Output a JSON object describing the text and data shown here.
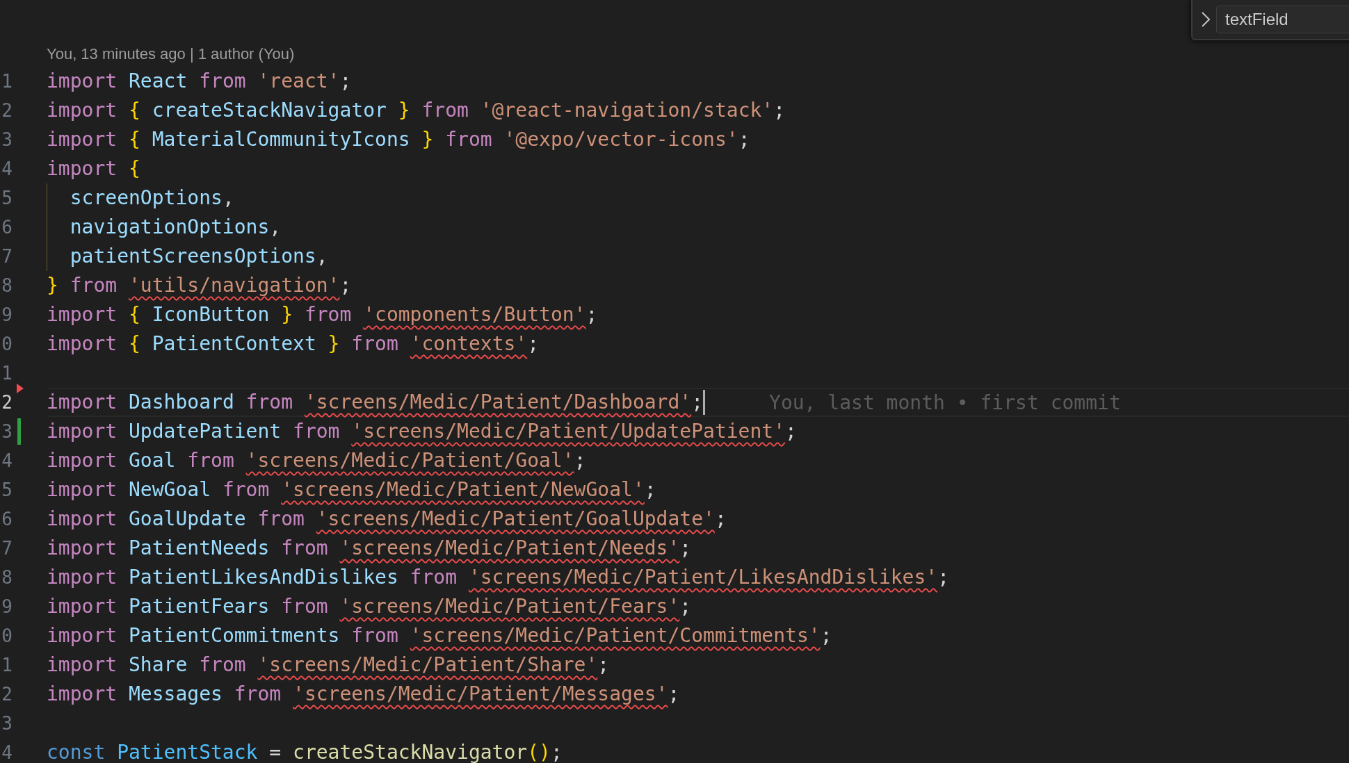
{
  "find_widget": {
    "value": "textField"
  },
  "codelens": "You, 13 minutes ago | 1 author (You)",
  "lines": [
    {
      "number": "1",
      "current": false,
      "tokens": [
        {
          "kind": "keyword",
          "text": "import "
        },
        {
          "kind": "ident",
          "text": "React "
        },
        {
          "kind": "keyword",
          "text": "from "
        },
        {
          "kind": "string",
          "text": "'react'"
        },
        {
          "kind": "punct",
          "text": ";"
        }
      ]
    },
    {
      "number": "2",
      "current": false,
      "tokens": [
        {
          "kind": "keyword",
          "text": "import "
        },
        {
          "kind": "brace",
          "text": "{ "
        },
        {
          "kind": "ident",
          "text": "createStackNavigator "
        },
        {
          "kind": "brace",
          "text": "} "
        },
        {
          "kind": "keyword",
          "text": "from "
        },
        {
          "kind": "string",
          "text": "'@react-navigation/stack'"
        },
        {
          "kind": "punct",
          "text": ";"
        }
      ]
    },
    {
      "number": "3",
      "current": false,
      "tokens": [
        {
          "kind": "keyword",
          "text": "import "
        },
        {
          "kind": "brace",
          "text": "{ "
        },
        {
          "kind": "ident",
          "text": "MaterialCommunityIcons "
        },
        {
          "kind": "brace",
          "text": "} "
        },
        {
          "kind": "keyword",
          "text": "from "
        },
        {
          "kind": "string",
          "text": "'@expo/vector-icons'"
        },
        {
          "kind": "punct",
          "text": ";"
        }
      ]
    },
    {
      "number": "4",
      "current": false,
      "tokens": [
        {
          "kind": "keyword",
          "text": "import "
        },
        {
          "kind": "brace",
          "text": "{"
        }
      ]
    },
    {
      "number": "5",
      "current": false,
      "indent_guide": true,
      "tokens": [
        {
          "kind": "ident",
          "text": "  screenOptions"
        },
        {
          "kind": "punct",
          "text": ","
        }
      ]
    },
    {
      "number": "6",
      "current": false,
      "indent_guide": true,
      "tokens": [
        {
          "kind": "ident",
          "text": "  navigationOptions"
        },
        {
          "kind": "punct",
          "text": ","
        }
      ]
    },
    {
      "number": "7",
      "current": false,
      "indent_guide": true,
      "tokens": [
        {
          "kind": "ident",
          "text": "  patientScreensOptions"
        },
        {
          "kind": "punct",
          "text": ","
        }
      ]
    },
    {
      "number": "8",
      "current": false,
      "tokens": [
        {
          "kind": "brace",
          "text": "} "
        },
        {
          "kind": "keyword",
          "text": "from "
        },
        {
          "kind": "string",
          "text": "'utils/navigation'",
          "squiggle": true
        },
        {
          "kind": "punct",
          "text": ";"
        }
      ]
    },
    {
      "number": "9",
      "current": false,
      "tokens": [
        {
          "kind": "keyword",
          "text": "import "
        },
        {
          "kind": "brace",
          "text": "{ "
        },
        {
          "kind": "ident",
          "text": "IconButton "
        },
        {
          "kind": "brace",
          "text": "} "
        },
        {
          "kind": "keyword",
          "text": "from "
        },
        {
          "kind": "string",
          "text": "'components/Button'",
          "squiggle": true
        },
        {
          "kind": "punct",
          "text": ";"
        }
      ]
    },
    {
      "number": "0",
      "current": false,
      "tokens": [
        {
          "kind": "keyword",
          "text": "import "
        },
        {
          "kind": "brace",
          "text": "{ "
        },
        {
          "kind": "ident",
          "text": "PatientContext "
        },
        {
          "kind": "brace",
          "text": "} "
        },
        {
          "kind": "keyword",
          "text": "from "
        },
        {
          "kind": "string",
          "text": "'contexts'",
          "squiggle": true
        },
        {
          "kind": "punct",
          "text": ";"
        }
      ]
    },
    {
      "number": "1",
      "current": false
    },
    {
      "number": "2",
      "current": true,
      "deleted_marker": true,
      "blame": "You, last month • first commit",
      "tokens": [
        {
          "kind": "keyword",
          "text": "import "
        },
        {
          "kind": "ident",
          "text": "Dashboard "
        },
        {
          "kind": "keyword",
          "text": "from "
        },
        {
          "kind": "string",
          "text": "'screens/Medic/Patient/Dashboard'",
          "squiggle": true
        },
        {
          "kind": "punct",
          "text": ";"
        }
      ]
    },
    {
      "number": "3",
      "current": false,
      "added_marker": true,
      "tokens": [
        {
          "kind": "keyword",
          "text": "import "
        },
        {
          "kind": "ident",
          "text": "UpdatePatient "
        },
        {
          "kind": "keyword",
          "text": "from "
        },
        {
          "kind": "string",
          "text": "'screens/Medic/Patient/UpdatePatient'",
          "squiggle": true
        },
        {
          "kind": "punct",
          "text": ";"
        }
      ]
    },
    {
      "number": "4",
      "current": false,
      "tokens": [
        {
          "kind": "keyword",
          "text": "import "
        },
        {
          "kind": "ident",
          "text": "Goal "
        },
        {
          "kind": "keyword",
          "text": "from "
        },
        {
          "kind": "string",
          "text": "'screens/Medic/Patient/Goal'",
          "squiggle": true
        },
        {
          "kind": "punct",
          "text": ";"
        }
      ]
    },
    {
      "number": "5",
      "current": false,
      "tokens": [
        {
          "kind": "keyword",
          "text": "import "
        },
        {
          "kind": "ident",
          "text": "NewGoal "
        },
        {
          "kind": "keyword",
          "text": "from "
        },
        {
          "kind": "string",
          "text": "'screens/Medic/Patient/NewGoal'",
          "squiggle": true
        },
        {
          "kind": "punct",
          "text": ";"
        }
      ]
    },
    {
      "number": "6",
      "current": false,
      "tokens": [
        {
          "kind": "keyword",
          "text": "import "
        },
        {
          "kind": "ident",
          "text": "GoalUpdate "
        },
        {
          "kind": "keyword",
          "text": "from "
        },
        {
          "kind": "string",
          "text": "'screens/Medic/Patient/GoalUpdate'",
          "squiggle": true
        },
        {
          "kind": "punct",
          "text": ";"
        }
      ]
    },
    {
      "number": "7",
      "current": false,
      "tokens": [
        {
          "kind": "keyword",
          "text": "import "
        },
        {
          "kind": "ident",
          "text": "PatientNeeds "
        },
        {
          "kind": "keyword",
          "text": "from "
        },
        {
          "kind": "string",
          "text": "'screens/Medic/Patient/Needs'",
          "squiggle": true
        },
        {
          "kind": "punct",
          "text": ";"
        }
      ]
    },
    {
      "number": "8",
      "current": false,
      "tokens": [
        {
          "kind": "keyword",
          "text": "import "
        },
        {
          "kind": "ident",
          "text": "PatientLikesAndDislikes "
        },
        {
          "kind": "keyword",
          "text": "from "
        },
        {
          "kind": "string",
          "text": "'screens/Medic/Patient/LikesAndDislikes'",
          "squiggle": true
        },
        {
          "kind": "punct",
          "text": ";"
        }
      ]
    },
    {
      "number": "9",
      "current": false,
      "tokens": [
        {
          "kind": "keyword",
          "text": "import "
        },
        {
          "kind": "ident",
          "text": "PatientFears "
        },
        {
          "kind": "keyword",
          "text": "from "
        },
        {
          "kind": "string",
          "text": "'screens/Medic/Patient/Fears'",
          "squiggle": true
        },
        {
          "kind": "punct",
          "text": ";"
        }
      ]
    },
    {
      "number": "0",
      "current": false,
      "tokens": [
        {
          "kind": "keyword",
          "text": "import "
        },
        {
          "kind": "ident",
          "text": "PatientCommitments "
        },
        {
          "kind": "keyword",
          "text": "from "
        },
        {
          "kind": "string",
          "text": "'screens/Medic/Patient/Commitments'",
          "squiggle": true
        },
        {
          "kind": "punct",
          "text": ";"
        }
      ]
    },
    {
      "number": "1",
      "current": false,
      "tokens": [
        {
          "kind": "keyword",
          "text": "import "
        },
        {
          "kind": "ident",
          "text": "Share "
        },
        {
          "kind": "keyword",
          "text": "from "
        },
        {
          "kind": "string",
          "text": "'screens/Medic/Patient/Share'",
          "squiggle": true
        },
        {
          "kind": "punct",
          "text": ";"
        }
      ]
    },
    {
      "number": "2",
      "current": false,
      "tokens": [
        {
          "kind": "keyword",
          "text": "import "
        },
        {
          "kind": "ident",
          "text": "Messages "
        },
        {
          "kind": "keyword",
          "text": "from "
        },
        {
          "kind": "string",
          "text": "'screens/Medic/Patient/Messages'",
          "squiggle": true
        },
        {
          "kind": "punct",
          "text": ";"
        }
      ]
    },
    {
      "number": "3",
      "current": false
    },
    {
      "number": "4",
      "current": false,
      "tokens": [
        {
          "kind": "storage",
          "text": "const "
        },
        {
          "kind": "constant",
          "text": "PatientStack "
        },
        {
          "kind": "punct",
          "text": "= "
        },
        {
          "kind": "function",
          "text": "createStackNavigator"
        },
        {
          "kind": "brace",
          "text": "()"
        },
        {
          "kind": "punct",
          "text": ";"
        }
      ]
    }
  ]
}
